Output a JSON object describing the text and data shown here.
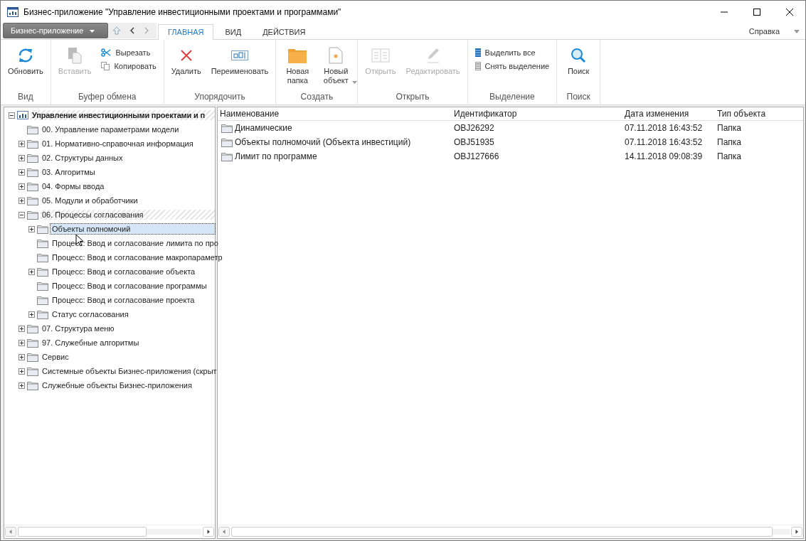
{
  "window": {
    "title": "Бизнес-приложение \"Управление инвестиционными проектами и программами\""
  },
  "app_menu": {
    "label": "Бизнес-приложение"
  },
  "tabs": [
    {
      "label": "ГЛАВНАЯ",
      "selected": true
    },
    {
      "label": "ВИД",
      "selected": false
    },
    {
      "label": "ДЕЙСТВИЯ",
      "selected": false
    }
  ],
  "help": {
    "label": "Справка"
  },
  "ribbon": [
    {
      "title": "Вид",
      "buttons": [
        {
          "label": "Обновить",
          "kind": "large",
          "disabled": false
        }
      ]
    },
    {
      "title": "Буфер обмена",
      "buttons": [
        {
          "label": "Вставить",
          "kind": "large",
          "disabled": true
        },
        {
          "label": "Вырезать",
          "kind": "small",
          "disabled": false
        },
        {
          "label": "Копировать",
          "kind": "small",
          "disabled": false
        }
      ]
    },
    {
      "title": "Упорядочить",
      "buttons": [
        {
          "label": "Удалить",
          "kind": "large",
          "disabled": false
        },
        {
          "label": "Переименовать",
          "kind": "large",
          "disabled": false
        }
      ]
    },
    {
      "title": "Создать",
      "buttons": [
        {
          "label": "Новая папка",
          "kind": "large",
          "disabled": false
        },
        {
          "label": "Новый объект",
          "kind": "split",
          "disabled": false
        }
      ]
    },
    {
      "title": "Открыть",
      "buttons": [
        {
          "label": "Открыть",
          "kind": "large",
          "disabled": true
        },
        {
          "label": "Редактировать",
          "kind": "large",
          "disabled": true
        }
      ]
    },
    {
      "title": "Выделение",
      "buttons": [
        {
          "label": "Выделить все",
          "kind": "small",
          "disabled": false
        },
        {
          "label": "Снять выделение",
          "kind": "small",
          "disabled": false
        }
      ]
    },
    {
      "title": "Поиск",
      "buttons": [
        {
          "label": "Поиск",
          "kind": "large",
          "disabled": false
        }
      ]
    }
  ],
  "tree": [
    {
      "label": "Управление инвестиционными проектами и п",
      "kind": "root",
      "expanded": true,
      "selected": false,
      "highlighted": true,
      "children": [
        {
          "label": "00. Управление параметрами модели",
          "kind": "leaf",
          "selected": false,
          "highlighted": false
        },
        {
          "label": "01. Нормативно-справочная информация",
          "kind": "group",
          "expanded": false,
          "selected": false,
          "highlighted": false
        },
        {
          "label": "02. Структуры данных",
          "kind": "group",
          "expanded": false,
          "selected": false,
          "highlighted": false
        },
        {
          "label": "03. Алгоритмы",
          "kind": "group",
          "expanded": false,
          "selected": false,
          "highlighted": false
        },
        {
          "label": "04. Формы ввода",
          "kind": "group",
          "expanded": false,
          "selected": false,
          "highlighted": false
        },
        {
          "label": "05. Модули и обработчики",
          "kind": "group",
          "expanded": false,
          "selected": false,
          "highlighted": false
        },
        {
          "label": "06. Процессы согласования",
          "kind": "group",
          "expanded": true,
          "selected": false,
          "highlighted": true,
          "children": [
            {
              "label": "Объекты полномочий",
              "kind": "group",
              "expanded": false,
              "selected": true,
              "highlighted": false
            },
            {
              "label": "Процесс: Ввод и согласование лимита по про",
              "kind": "leaf",
              "selected": false,
              "highlighted": false
            },
            {
              "label": "Процесс: Ввод и согласование макропараметр",
              "kind": "leaf",
              "selected": false,
              "highlighted": false
            },
            {
              "label": "Процесс: Ввод и согласование объекта",
              "kind": "group",
              "expanded": false,
              "selected": false,
              "highlighted": false
            },
            {
              "label": "Процесс: Ввод и согласование программы",
              "kind": "leaf",
              "selected": false,
              "highlighted": false
            },
            {
              "label": "Процесс: Ввод и согласование проекта",
              "kind": "leaf",
              "selected": false,
              "highlighted": false
            },
            {
              "label": "Статус согласования",
              "kind": "group",
              "expanded": false,
              "selected": false,
              "highlighted": false
            }
          ]
        },
        {
          "label": "07. Структура меню",
          "kind": "group",
          "expanded": false,
          "selected": false,
          "highlighted": false
        },
        {
          "label": "97. Служебные алгоритмы",
          "kind": "group",
          "expanded": false,
          "selected": false,
          "highlighted": false
        },
        {
          "label": "Сервис",
          "kind": "group",
          "expanded": false,
          "selected": false,
          "highlighted": false
        },
        {
          "label": "Системные объекты Бизнес-приложения (скрыт",
          "kind": "group",
          "expanded": false,
          "selected": false,
          "highlighted": false
        },
        {
          "label": "Служебные объекты Бизнес-приложения",
          "kind": "group",
          "expanded": false,
          "selected": false,
          "highlighted": false
        }
      ]
    }
  ],
  "table": {
    "columns": [
      "Наименование",
      "Идентификатор",
      "Дата изменения",
      "Тип объекта"
    ],
    "rows": [
      [
        "Динамические",
        "OBJ26292",
        "07.11.2018 16:43:52",
        "Папка"
      ],
      [
        "Объекты полномочий (Объекта инвестиций)",
        "OBJ51935",
        "07.11.2018 16:43:52",
        "Папка"
      ],
      [
        "Лимит по программе",
        "OBJ127666",
        "14.11.2018 09:08:39",
        "Папка"
      ]
    ]
  }
}
